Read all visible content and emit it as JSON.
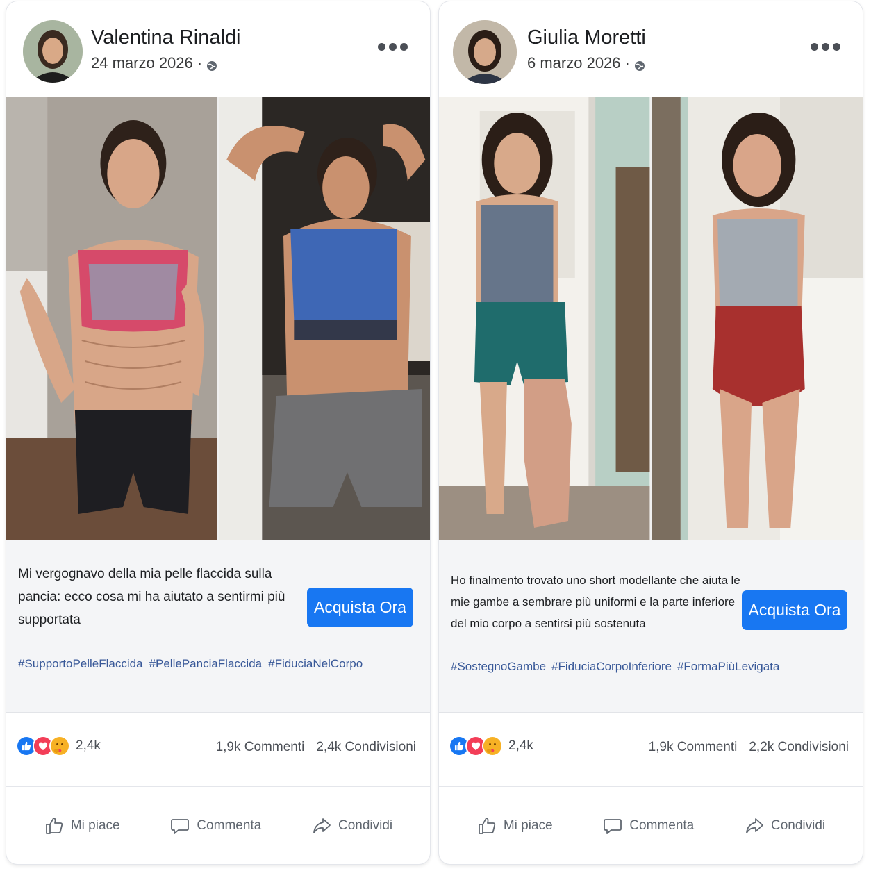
{
  "posts": [
    {
      "author": "Valentina Rinaldi",
      "date": "24 marzo 2026 · ",
      "caption": "Mi vergognavo della mia pelle flaccida sulla pancia: ecco cosa mi ha aiutato a sentirmi più supportata",
      "cta": "Acquista Ora",
      "hashtags": [
        "#SupportoPelleFlaccida",
        "#PellePanciaFlaccida",
        "#FiduciaNelCorpo"
      ],
      "reaction_count": "2,4k",
      "comments": "1,9k Commenti",
      "shares": "2,4k Condivisioni",
      "actions": {
        "like": "Mi piace",
        "comment": "Commenta",
        "share": "Condividi"
      }
    },
    {
      "author": "Giulia Moretti",
      "date": "6 marzo 2026 · ",
      "caption": "Ho finalmento trovato uno short modellante che aiuta le mie gambe a sembrare più uniformi e la parte inferiore del mio corpo a sentirsi più sostenuta",
      "cta": "Acquista Ora",
      "hashtags": [
        "#SostegnoGambe",
        "#FiduciaCorpoInferiore",
        "#FormaPiùLevigata"
      ],
      "reaction_count": "2,4k",
      "comments": "1,9k Commenti",
      "shares": "2,2k Condivisioni",
      "actions": {
        "like": "Mi piace",
        "comment": "Commenta",
        "share": "Condividi"
      }
    }
  ],
  "colors": {
    "accent": "#1877f2",
    "hashtag": "#385898",
    "like": "#1877f2",
    "love": "#f33e58",
    "care": "#f7b125"
  },
  "icons": [
    "globe-icon",
    "more-icon",
    "like-reaction-icon",
    "love-reaction-icon",
    "care-reaction-icon",
    "thumbs-up-icon",
    "comment-icon",
    "share-icon"
  ]
}
